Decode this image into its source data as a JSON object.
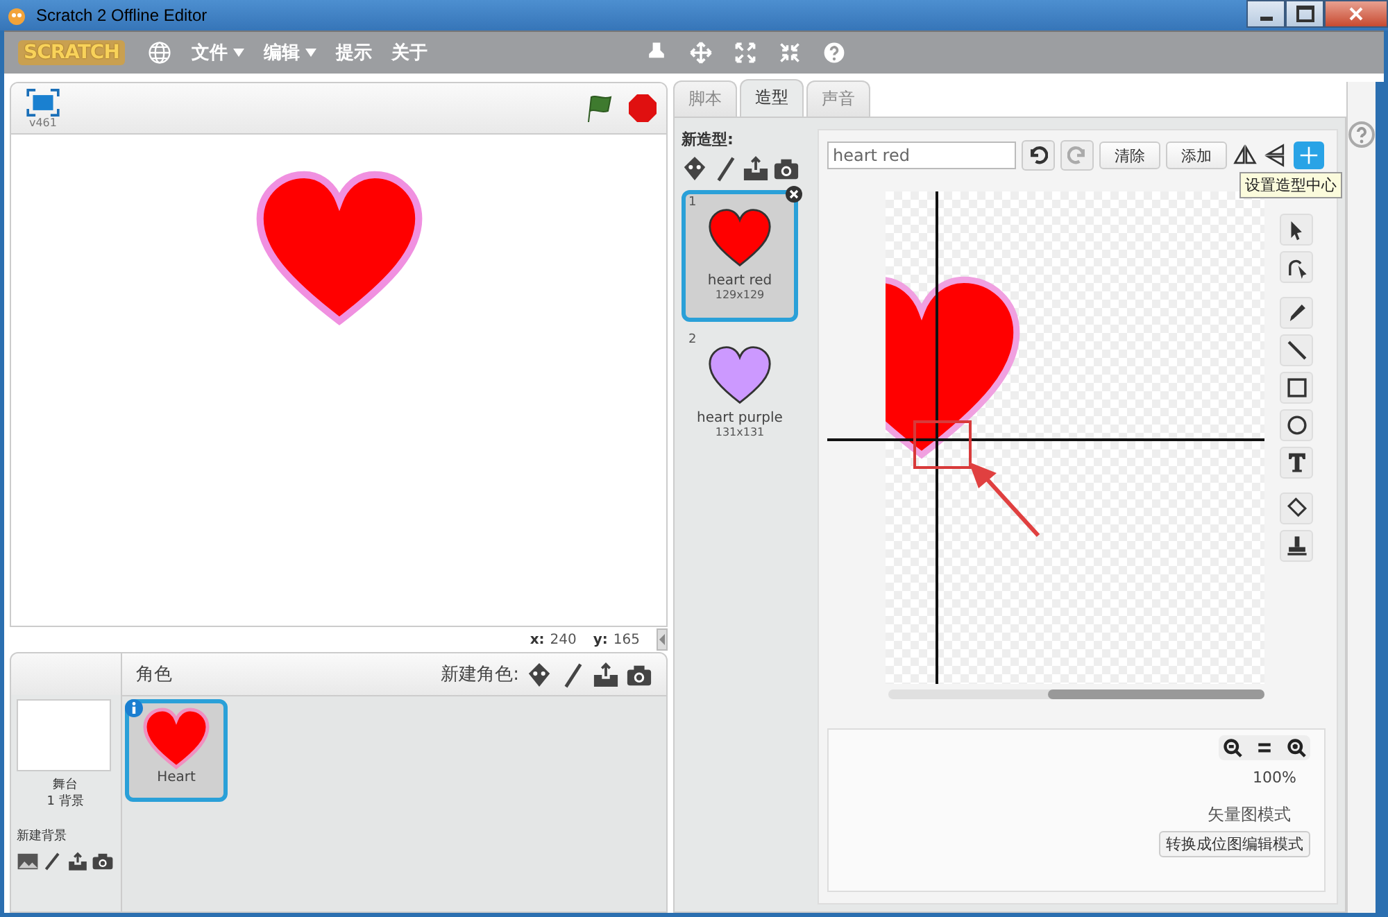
{
  "window": {
    "title": "Scratch 2 Offline Editor"
  },
  "menu": {
    "logo": "SCRATCH",
    "items": [
      {
        "label": "文件",
        "dropdown": true
      },
      {
        "label": "编辑",
        "dropdown": true
      },
      {
        "label": "提示",
        "dropdown": false
      },
      {
        "label": "关于",
        "dropdown": false
      }
    ]
  },
  "stage": {
    "version": "v461",
    "x_label": "x:",
    "x_value": "240",
    "y_label": "y:",
    "y_value": "165"
  },
  "sprites": {
    "title": "角色",
    "new_sprite_label": "新建角色:",
    "stage_name": "舞台",
    "backdrop_count": "1 背景",
    "new_backdrop_label": "新建背景",
    "items": [
      {
        "name": "Heart",
        "selected": true
      }
    ]
  },
  "tabs": [
    {
      "label": "脚本",
      "selected": false
    },
    {
      "label": "造型",
      "selected": true
    },
    {
      "label": "声音",
      "selected": false
    }
  ],
  "costumes": {
    "new_label": "新造型:",
    "items": [
      {
        "number": "1",
        "name": "heart red",
        "size": "129x129",
        "color": "#ff0000",
        "selected": true
      },
      {
        "number": "2",
        "name": "heart purple",
        "size": "131x131",
        "color": "#cc99ff",
        "selected": false
      }
    ]
  },
  "editor": {
    "name_value": "heart red",
    "clear_button": "清除",
    "add_button": "添加",
    "tooltip": "设置造型中心",
    "zoom": "100%",
    "mode_label": "矢量图模式",
    "convert_button": "转换成位图编辑模式"
  }
}
